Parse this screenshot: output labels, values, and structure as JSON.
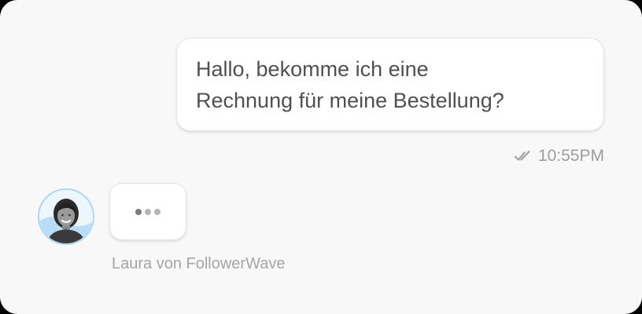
{
  "conversation": {
    "user_message": {
      "lines": [
        "Hallo, bekomme ich eine",
        "Rechnung für meine Bestellung?"
      ],
      "time": "10:55PM",
      "status_icon": "double-check-icon"
    },
    "agent": {
      "name_label": "Laura von FollowerWave",
      "avatar_icon": "agent-avatar",
      "typing_indicator_icon": "typing-dots-icon"
    }
  },
  "colors": {
    "card_background": "#f8f8f8",
    "bubble_background": "#ffffff",
    "message_text": "#505050",
    "meta_text": "#9d9d9d",
    "avatar_ring": "#a9d8f6"
  }
}
